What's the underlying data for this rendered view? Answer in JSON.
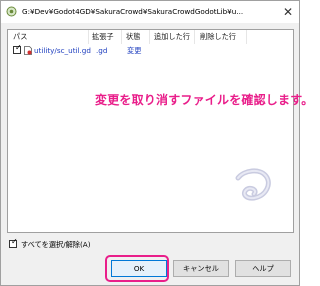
{
  "window": {
    "title": "G:¥Dev¥Godot4GD¥SakuraCrowd¥SakuraCrowdGodotLib¥u...",
    "close_glyph": "✕"
  },
  "list": {
    "columns": [
      "パス",
      "拡張子",
      "状態",
      "追加した行",
      "削除した行"
    ],
    "rows": [
      {
        "checked": true,
        "path": "utility/sc_util.gd",
        "ext": ".gd",
        "state": "変更"
      }
    ]
  },
  "annotation": "変更を取り消すファイルを確認します。",
  "select_all": {
    "checked": true,
    "label": "すべてを選択/解除(A)"
  },
  "buttons": {
    "ok": "OK",
    "cancel": "キャンセル",
    "help": "ヘルプ"
  },
  "colors": {
    "annotation": "#e91e8a",
    "link_text": "#1f3fbf",
    "accent": "#0078d7"
  },
  "icons": {
    "app": "tortoisegit-icon",
    "file": "modified-file-icon",
    "watermark": "tortoise-swirl-icon"
  }
}
